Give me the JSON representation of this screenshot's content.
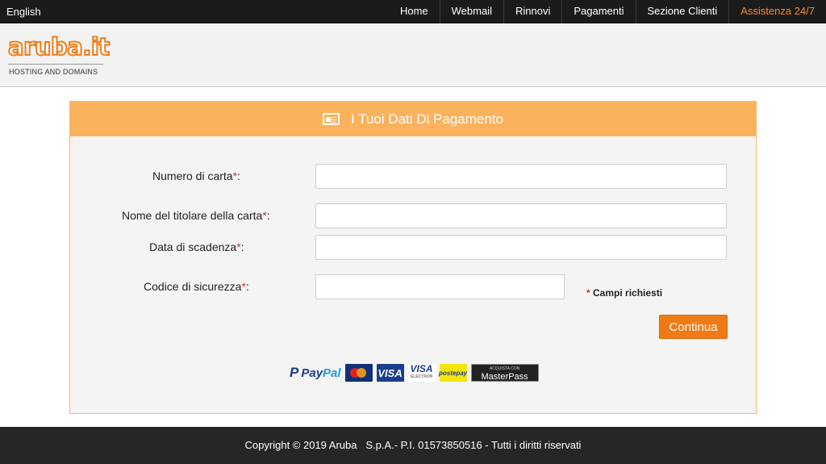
{
  "topbar": {
    "language": "English",
    "nav": [
      {
        "label": "Home"
      },
      {
        "label": "Webmail"
      },
      {
        "label": "Rinnovi"
      },
      {
        "label": "Pagamenti"
      },
      {
        "label": "Sezione Clienti"
      },
      {
        "label": "Assistenza 24/7"
      }
    ]
  },
  "brand": {
    "logo_text": "aruba.it",
    "tagline": "HOSTING AND DOMAINS"
  },
  "form": {
    "title": "I Tuoi Dati Di Pagamento",
    "card_number_label": "Numero di carta",
    "holder_label": "Nome del titolare della carta",
    "expiry_label": "Data di scadenza",
    "cvv_label": "Codice di sicurezza",
    "required_mark": "*",
    "label_suffix": ":",
    "card_number_value": "",
    "holder_value": "",
    "expiry_value": "",
    "cvv_value": "",
    "required_note": "Campi richiesti",
    "continue_label": "Continua"
  },
  "payment_logos": {
    "paypal_pay": "Pay",
    "paypal_pal": "Pal",
    "paypal_p": "P",
    "mastercard": "MasterCard",
    "visa": "VISA",
    "visa_electron": "VISA",
    "visa_electron_sub": "ELECTRON",
    "postepay": "postepay",
    "masterpass_sub": "ACQUISTA CON",
    "masterpass": "MasterPass"
  },
  "footer": {
    "text": "Copyright © 2019 Aruba   S.p.A.- P.I. 01573850516 - Tutti i diritti riservati"
  },
  "colors": {
    "accent": "#f07a16",
    "panel_header": "#fbb25c",
    "topbar": "#1b1b1b"
  }
}
